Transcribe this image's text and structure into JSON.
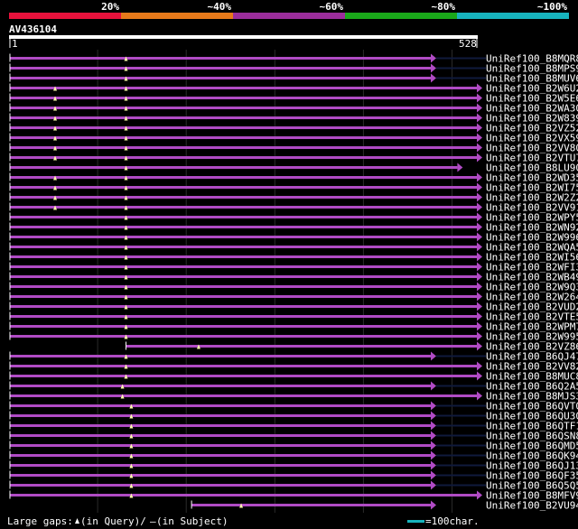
{
  "query": {
    "name": "AV436104",
    "start": "1",
    "end": "528",
    "length": 528
  },
  "identity_legend": [
    {
      "label": "20%",
      "color": "#e8123c"
    },
    {
      "label": "~40%",
      "color": "#e87a1a"
    },
    {
      "label": "~60%",
      "color": "#9b2d9b"
    },
    {
      "label": "~80%",
      "color": "#1aa81a"
    },
    {
      "label": "~100%",
      "color": "#17b3bd"
    }
  ],
  "hits": [
    {
      "id": "UniRef100_B8MQR8",
      "end": 476,
      "tail": true,
      "marks": [
        132
      ]
    },
    {
      "id": "UniRef100_B8MPS9",
      "end": 476,
      "tail": true,
      "marks": [
        132
      ]
    },
    {
      "id": "UniRef100_B8MUV6",
      "end": 476,
      "tail": true,
      "marks": [
        132
      ]
    },
    {
      "id": "UniRef100_B2W6U2",
      "end": 528,
      "tail": false,
      "marks": [
        52,
        132
      ]
    },
    {
      "id": "UniRef100_B2W5E6",
      "end": 528,
      "tail": false,
      "marks": [
        52,
        132
      ]
    },
    {
      "id": "UniRef100_B2WA30",
      "end": 528,
      "tail": false,
      "marks": [
        52,
        132
      ]
    },
    {
      "id": "UniRef100_B2W839",
      "end": 528,
      "tail": false,
      "marks": [
        52,
        132
      ]
    },
    {
      "id": "UniRef100_B2VZ52",
      "end": 528,
      "tail": false,
      "marks": [
        52,
        132
      ]
    },
    {
      "id": "UniRef100_B2VX59",
      "end": 528,
      "tail": false,
      "marks": [
        52,
        132
      ]
    },
    {
      "id": "UniRef100_B2VV80",
      "end": 528,
      "tail": false,
      "marks": [
        52,
        132
      ]
    },
    {
      "id": "UniRef100_B2VTU7",
      "end": 528,
      "tail": false,
      "marks": [
        52,
        132
      ]
    },
    {
      "id": "UniRef100_B8LU90",
      "end": 506,
      "tail": false,
      "marks": [
        132
      ]
    },
    {
      "id": "UniRef100_B2WD35",
      "end": 528,
      "tail": false,
      "marks": [
        52,
        132
      ]
    },
    {
      "id": "UniRef100_B2WI75",
      "end": 528,
      "tail": false,
      "marks": [
        52,
        132
      ]
    },
    {
      "id": "UniRef100_B2W2Z2",
      "end": 528,
      "tail": false,
      "marks": [
        52,
        132
      ]
    },
    {
      "id": "UniRef100_B2VV91",
      "end": 528,
      "tail": false,
      "marks": [
        52,
        132
      ]
    },
    {
      "id": "UniRef100_B2WPY5",
      "end": 528,
      "tail": false,
      "marks": [
        132
      ]
    },
    {
      "id": "UniRef100_B2WN92",
      "end": 528,
      "tail": false,
      "marks": [
        132
      ]
    },
    {
      "id": "UniRef100_B2W996",
      "end": 528,
      "tail": false,
      "marks": [
        132
      ]
    },
    {
      "id": "UniRef100_B2WQA5",
      "end": 528,
      "tail": false,
      "marks": [
        132
      ]
    },
    {
      "id": "UniRef100_B2WI56",
      "end": 528,
      "tail": false,
      "marks": [
        132
      ]
    },
    {
      "id": "UniRef100_B2WFI3",
      "end": 528,
      "tail": false,
      "marks": [
        132
      ]
    },
    {
      "id": "UniRef100_B2WB49",
      "end": 528,
      "tail": false,
      "marks": [
        132
      ]
    },
    {
      "id": "UniRef100_B2W9Q3",
      "end": 528,
      "tail": false,
      "marks": [
        132
      ]
    },
    {
      "id": "UniRef100_B2W264",
      "end": 528,
      "tail": false,
      "marks": [
        132
      ]
    },
    {
      "id": "UniRef100_B2VUD2",
      "end": 528,
      "tail": false,
      "marks": [
        132
      ]
    },
    {
      "id": "UniRef100_B2VTE5",
      "end": 528,
      "tail": false,
      "marks": [
        132
      ]
    },
    {
      "id": "UniRef100_B2WPM7",
      "end": 528,
      "tail": false,
      "marks": [
        132
      ]
    },
    {
      "id": "UniRef100_B2W995",
      "end": 528,
      "tail": false,
      "marks": [
        132
      ]
    },
    {
      "id": "UniRef100_B2VZ86",
      "start": 132,
      "end": 528,
      "tail": false,
      "marks": [
        214
      ]
    },
    {
      "id": "UniRef100_B6QJ47",
      "end": 476,
      "tail": true,
      "marks": [
        132
      ]
    },
    {
      "id": "UniRef100_B2VV82",
      "end": 528,
      "tail": false,
      "marks": [
        132
      ]
    },
    {
      "id": "UniRef100_B8MUC8",
      "end": 528,
      "tail": false,
      "marks": [
        132
      ]
    },
    {
      "id": "UniRef100_B6Q2A5",
      "end": 476,
      "tail": true,
      "marks": [
        128
      ]
    },
    {
      "id": "UniRef100_B8MJS3",
      "end": 528,
      "tail": false,
      "marks": [
        128
      ]
    },
    {
      "id": "UniRef100_B6QVT0",
      "end": 476,
      "tail": true,
      "marks": [
        138
      ]
    },
    {
      "id": "UniRef100_B6QU30",
      "end": 476,
      "tail": true,
      "marks": [
        138
      ]
    },
    {
      "id": "UniRef100_B6QTF1",
      "end": 476,
      "tail": true,
      "marks": [
        138
      ]
    },
    {
      "id": "UniRef100_B6QSN8",
      "end": 476,
      "tail": true,
      "marks": [
        138
      ]
    },
    {
      "id": "UniRef100_B6QMD5",
      "end": 476,
      "tail": true,
      "marks": [
        138
      ]
    },
    {
      "id": "UniRef100_B6QK94",
      "end": 476,
      "tail": true,
      "marks": [
        138
      ]
    },
    {
      "id": "UniRef100_B6QJ13",
      "end": 476,
      "tail": true,
      "marks": [
        138
      ]
    },
    {
      "id": "UniRef100_B6QF35",
      "end": 476,
      "tail": true,
      "marks": [
        138
      ]
    },
    {
      "id": "UniRef100_B6Q5Q5",
      "end": 476,
      "tail": true,
      "marks": [
        138
      ]
    },
    {
      "id": "UniRef100_B8MFV9",
      "end": 528,
      "tail": false,
      "marks": [
        138
      ]
    },
    {
      "id": "UniRef100_B2VU94",
      "start": 206,
      "end": 476,
      "tail": false,
      "marks": [
        262
      ]
    }
  ],
  "footer": {
    "large_gaps_label": "Large gaps:",
    "query_gap_text": "(in Query)/",
    "subject_gap_dash": "–",
    "subject_gap_text": " (in Subject)",
    "scale_text": "=100char.",
    "scale_color": "#17b3bd"
  },
  "hit_color": "#b04bc4",
  "tail_color": "#101a3c"
}
